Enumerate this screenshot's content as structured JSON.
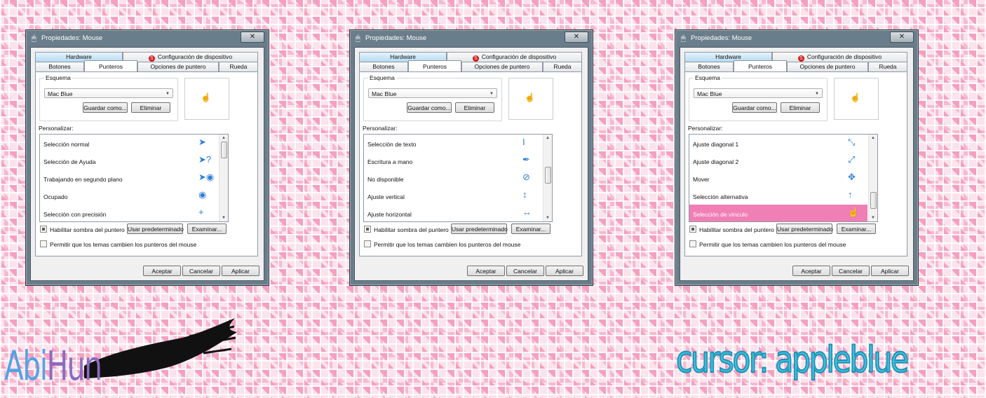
{
  "windows": [
    {
      "title": "Propiedades: Mouse",
      "close_label": "✕",
      "tabs_top": {
        "hardware": "Hardware",
        "config": "Configuración de dispositivo"
      },
      "tabs_bottom": [
        "Botones",
        "Punteros",
        "Opciones de puntero",
        "Rueda"
      ],
      "active_tab": "Punteros",
      "scheme_label": "Esquema",
      "scheme_value": "Mac Blue",
      "save_as_label": "Guardar como...",
      "delete_label": "Eliminar",
      "customize_label": "Personalizar:",
      "list_items": [
        {
          "label": "Selección normal",
          "icon": "arrow-cursor-icon",
          "glyph": "➤",
          "selected": false
        },
        {
          "label": "Selección de Ayuda",
          "icon": "help-cursor-icon",
          "glyph": "➤?",
          "selected": false
        },
        {
          "label": "Trabajando en segundo plano",
          "icon": "working-cursor-icon",
          "glyph": "➤◉",
          "selected": false
        },
        {
          "label": "Ocupado",
          "icon": "busy-cursor-icon",
          "glyph": "◉",
          "selected": false
        },
        {
          "label": "Selección con precisión",
          "icon": "crosshair-cursor-icon",
          "glyph": "+",
          "selected": false
        }
      ],
      "scroll_position": 0.0,
      "shadow_label": "Habilitar sombra del puntero",
      "shadow_checked": true,
      "default_label": "Usar predeterminado",
      "browse_label": "Examinar...",
      "themes_label": "Permitir que los temas cambien los punteros del mouse",
      "themes_checked": false,
      "ok_label": "Aceptar",
      "cancel_label": "Cancelar",
      "apply_label": "Aplicar"
    },
    {
      "title": "Propiedades: Mouse",
      "close_label": "✕",
      "tabs_top": {
        "hardware": "Hardware",
        "config": "Configuración de dispositivo"
      },
      "tabs_bottom": [
        "Botones",
        "Punteros",
        "Opciones de puntero",
        "Rueda"
      ],
      "active_tab": "Punteros",
      "scheme_label": "Esquema",
      "scheme_value": "Mac Blue",
      "save_as_label": "Guardar como...",
      "delete_label": "Eliminar",
      "customize_label": "Personalizar:",
      "list_items": [
        {
          "label": "Selección de texto",
          "icon": "text-cursor-icon",
          "glyph": "Ι",
          "selected": false
        },
        {
          "label": "Escritura a mano",
          "icon": "pen-cursor-icon",
          "glyph": "✒",
          "selected": false
        },
        {
          "label": "No disponible",
          "icon": "unavailable-cursor-icon",
          "glyph": "⊘",
          "selected": false
        },
        {
          "label": "Ajuste vertical",
          "icon": "resize-vertical-cursor-icon",
          "glyph": "↕",
          "selected": false
        },
        {
          "label": "Ajuste horizontal",
          "icon": "resize-horizontal-cursor-icon",
          "glyph": "↔",
          "selected": false
        }
      ],
      "scroll_position": 0.45,
      "shadow_label": "Habilitar sombra del puntero",
      "shadow_checked": true,
      "default_label": "Usar predeterminado",
      "browse_label": "Examinar...",
      "themes_label": "Permitir que los temas cambien los punteros del mouse",
      "themes_checked": false,
      "ok_label": "Aceptar",
      "cancel_label": "Cancelar",
      "apply_label": "Aplicar"
    },
    {
      "title": "Propiedades: Mouse",
      "close_label": "✕",
      "tabs_top": {
        "hardware": "Hardware",
        "config": "Configuración de dispositivo"
      },
      "tabs_bottom": [
        "Botones",
        "Punteros",
        "Opciones de puntero",
        "Rueda"
      ],
      "active_tab": "Punteros",
      "scheme_label": "Esquema",
      "scheme_value": "Mac Blue",
      "save_as_label": "Guardar como...",
      "delete_label": "Eliminar",
      "customize_label": "Personalizar:",
      "list_items": [
        {
          "label": "Ajuste diagonal 1",
          "icon": "resize-diagonal1-cursor-icon",
          "glyph": "⤡",
          "selected": false
        },
        {
          "label": "Ajuste diagonal 2",
          "icon": "resize-diagonal2-cursor-icon",
          "glyph": "⤢",
          "selected": false
        },
        {
          "label": "Mover",
          "icon": "move-cursor-icon",
          "glyph": "✥",
          "selected": false
        },
        {
          "label": "Selección alternativa",
          "icon": "alternate-cursor-icon",
          "glyph": "↑",
          "selected": false
        },
        {
          "label": "Selección de vínculo",
          "icon": "link-cursor-icon",
          "glyph": "☝",
          "selected": true
        }
      ],
      "scroll_position": 0.9,
      "shadow_label": "Habilitar sombra del puntero",
      "shadow_checked": true,
      "default_label": "Usar predeterminado",
      "browse_label": "Examinar...",
      "themes_label": "Permitir que los temas cambien los punteros del mouse",
      "themes_checked": false,
      "ok_label": "Aceptar",
      "cancel_label": "Cancelar",
      "apply_label": "Aplicar"
    }
  ],
  "branding": {
    "left_part1": "Abi",
    "left_part2": "Hun",
    "right": "cursor: appleblue"
  },
  "colors": {
    "selected_row": "#f07fb6",
    "window_frame": "#6a7d8a",
    "logo_blue": "#3fc1dc"
  }
}
